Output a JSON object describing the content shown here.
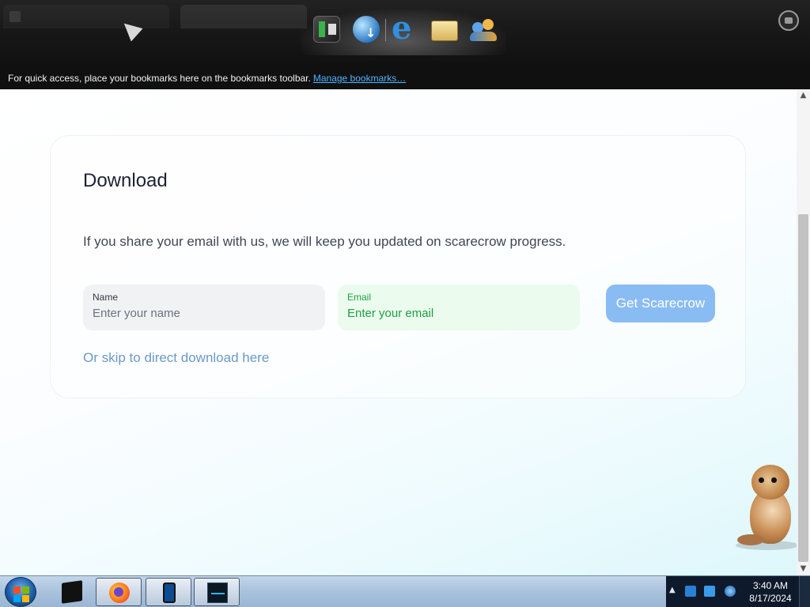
{
  "browser": {
    "bookmarks_bar": {
      "message": "For quick access, place your bookmarks here on the bookmarks toolbar.",
      "manage_link": "Manage bookmarks…"
    }
  },
  "page": {
    "title": "Download",
    "description": "If you share your email with us, we will keep you updated on scarecrow progress.",
    "form": {
      "name_label": "Name",
      "name_placeholder": "Enter your name",
      "email_label": "Email",
      "email_placeholder": "Enter your email",
      "submit_label": "Get Scarecrow"
    },
    "skip_link": "Or skip to direct download here"
  },
  "taskbar": {
    "clock_time": "3:40 AM",
    "clock_date": "8/17/2024"
  },
  "colors": {
    "button": "#8abcf4",
    "email_field_bg": "#ebfbee",
    "email_label": "#20a04a",
    "link": "#6b99c9"
  }
}
